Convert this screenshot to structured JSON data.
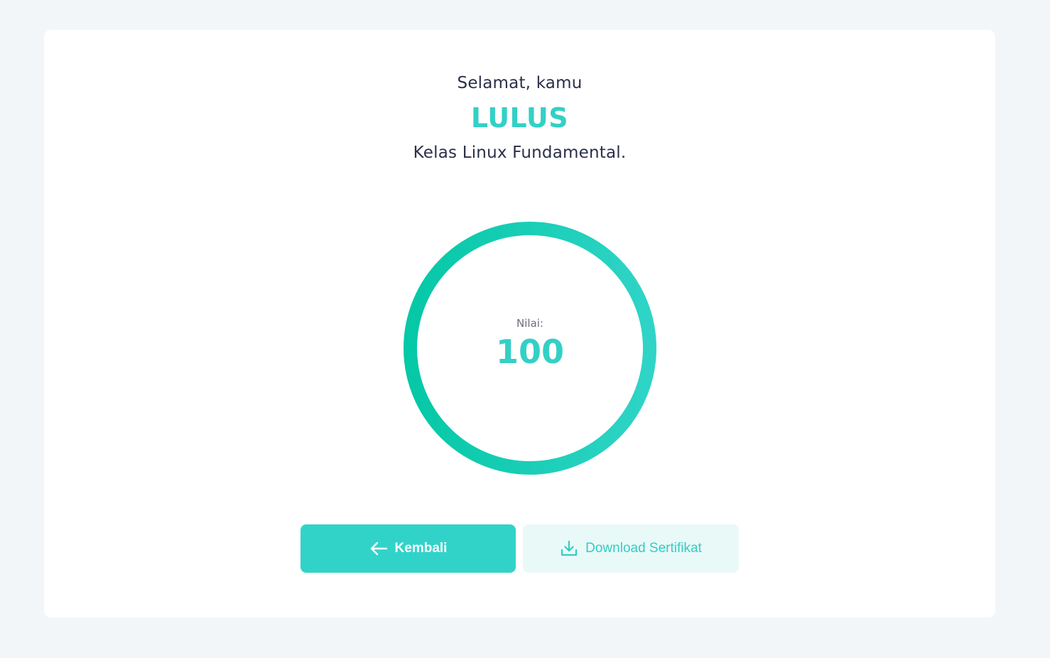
{
  "result": {
    "greeting": "Selamat, kamu",
    "status": "LULUS",
    "course": "Kelas Linux Fundamental."
  },
  "score": {
    "label": "Nilai:",
    "value": "100",
    "progress_percent": 100
  },
  "actions": {
    "back_label": "Kembali",
    "back_icon": "arrow-left-icon",
    "download_label": "Download Sertifikat",
    "download_icon": "download-icon"
  },
  "colors": {
    "accent": "#33d0c6",
    "ring_top": "#05c8a6",
    "ring_bottom": "#2fd4c7",
    "text_dark": "#2a2f4a",
    "page_bg": "#f3f6f9",
    "download_bg": "#e8f9f8"
  }
}
